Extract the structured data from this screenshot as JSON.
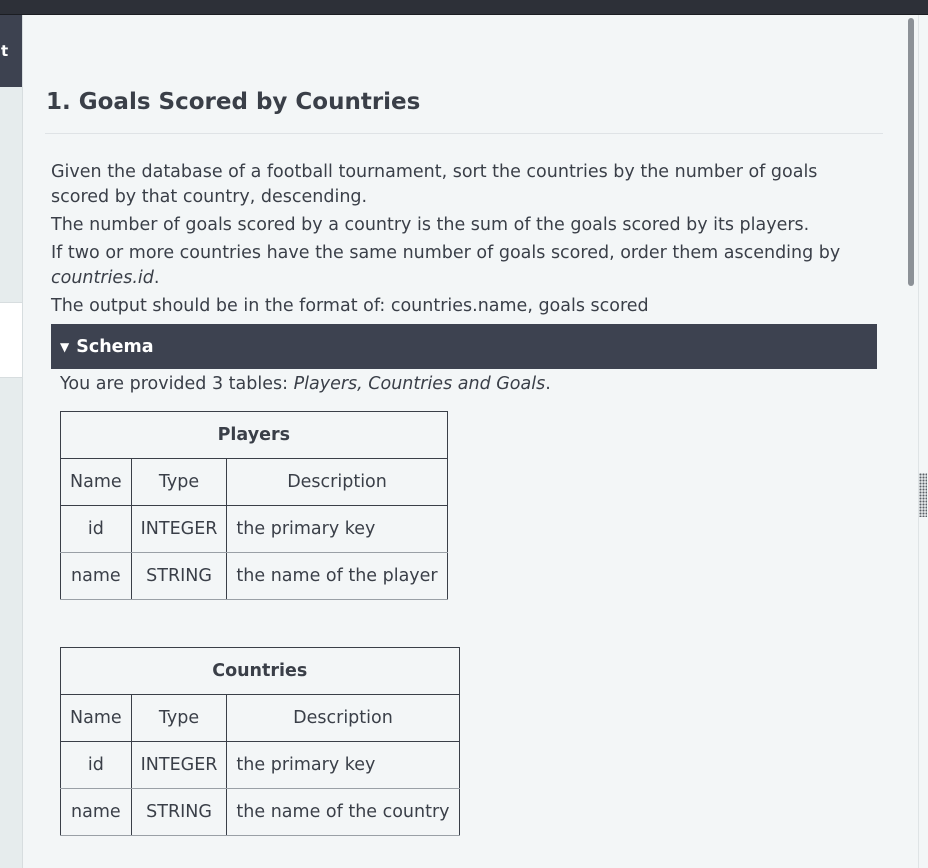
{
  "left_panel": {
    "tab_text": "t"
  },
  "problem": {
    "title": "1. Goals Scored by Countries",
    "paragraphs": [
      "Given the database of a football tournament, sort the countries by the number of goals scored by that country, descending.",
      "The number of goals scored by a country is the sum of the goals scored by its players.",
      "If two or more countries have the same number of goals scored, order them ascending by"
    ],
    "tiebreak_field": "countries.id",
    "tiebreak_end": ".",
    "output_format": "The output should be in the format of: countries.name, goals scored"
  },
  "schema": {
    "caret": "▼",
    "label": "Schema",
    "intro_prefix": "You are provided 3 tables: ",
    "intro_tables": "Players, Countries and Goals",
    "intro_suffix": ".",
    "tables": [
      {
        "title": "Players",
        "headers": [
          "Name",
          "Type",
          "Description"
        ],
        "rows": [
          [
            "id",
            "INTEGER",
            "the primary key"
          ],
          [
            "name",
            "STRING",
            "the name of the player"
          ]
        ]
      },
      {
        "title": "Countries",
        "headers": [
          "Name",
          "Type",
          "Description"
        ],
        "rows": [
          [
            "id",
            "INTEGER",
            "the primary key"
          ],
          [
            "name",
            "STRING",
            "the name of the country"
          ]
        ]
      }
    ]
  },
  "icons": {
    "collapse_caret": "triangle-down-icon",
    "resize_handle": "grip-dots-icon"
  }
}
